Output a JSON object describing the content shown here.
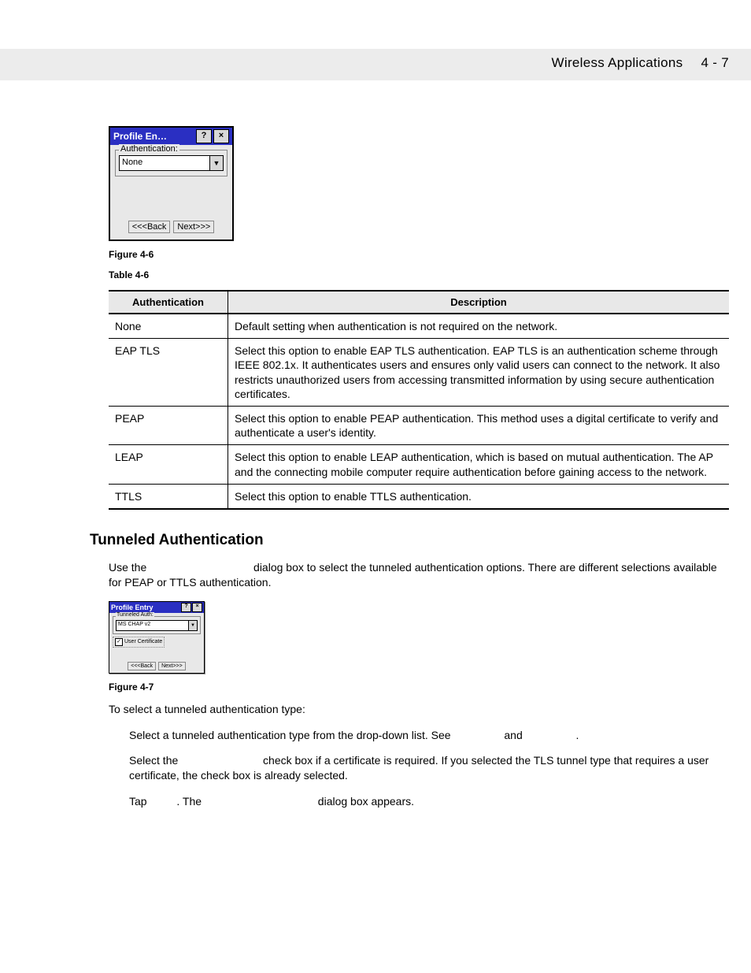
{
  "header": {
    "title": "Wireless Applications",
    "page": "4 - 7"
  },
  "dialog1": {
    "title": "Profile En…",
    "help": "?",
    "close": "×",
    "fieldset_label": "Authentication:",
    "combo_value": "None",
    "back": "<<<Back",
    "next": "Next>>>"
  },
  "fig46": "Figure 4-6",
  "tbl46_caption": "Table 4-6",
  "table": {
    "head_auth": "Authentication",
    "head_desc": "Description",
    "rows": [
      {
        "auth": "None",
        "desc": "Default setting when authentication is not required on the network."
      },
      {
        "auth": "EAP TLS",
        "desc": "Select this option to enable EAP TLS authentication. EAP TLS is an authentication scheme through IEEE 802.1x. It authenticates users and ensures only valid users can connect to the network. It also restricts unauthorized users from accessing transmitted information by using secure authentication certificates."
      },
      {
        "auth": "PEAP",
        "desc": "Select this option to enable PEAP authentication. This method uses a digital certificate to verify and authenticate a user's identity."
      },
      {
        "auth": "LEAP",
        "desc": "Select this option to enable LEAP authentication, which is based on mutual authentication. The AP and the connecting mobile computer require authentication before gaining access to the network."
      },
      {
        "auth": "TTLS",
        "desc": "Select this option to enable TTLS authentication."
      }
    ]
  },
  "section_heading": "Tunneled Authentication",
  "intro_p1a": "Use the ",
  "intro_p1b": " dialog box to select the tunneled authentication options. There are different selections available for PEAP or TTLS authentication.",
  "dialog2": {
    "title": "Profile Entry",
    "help": "?",
    "close": "×",
    "fieldset_label": "Tunneled Auth:",
    "combo_value": "MS CHAP v2",
    "checkbox_label": "User Certificate",
    "back": "<<<Back",
    "next": "Next>>>"
  },
  "fig47": "Figure 4-7",
  "lead2": "To select a tunneled authentication type:",
  "step1a": "Select a tunneled authentication type from the drop-down list. See ",
  "step1b": " and ",
  "step1c": ".",
  "step2a": "Select the ",
  "step2b": " check box if a certificate is required. If you selected the TLS tunnel type that requires a user certificate, the check box is already selected.",
  "step3a": "Tap ",
  "step3b": ". The ",
  "step3c": " dialog box appears."
}
